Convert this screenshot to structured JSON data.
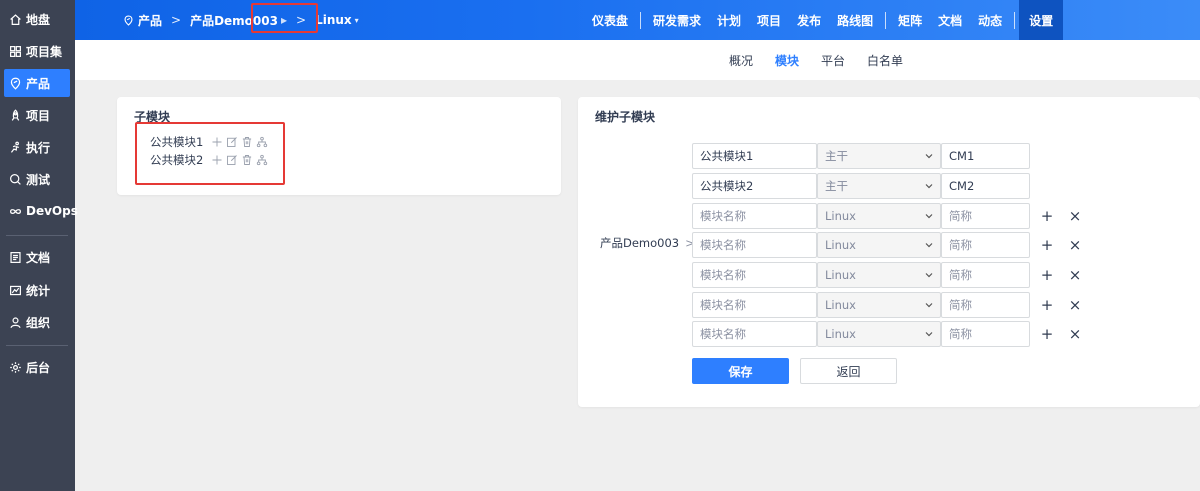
{
  "sidebar": {
    "items": [
      {
        "label": "地盘",
        "icon": "home-icon"
      },
      {
        "label": "项目集",
        "icon": "grid-icon"
      },
      {
        "label": "产品",
        "icon": "product-icon"
      },
      {
        "label": "项目",
        "icon": "rocket-icon"
      },
      {
        "label": "执行",
        "icon": "run-icon"
      },
      {
        "label": "测试",
        "icon": "test-icon"
      },
      {
        "label": "DevOps",
        "icon": "infinity-icon"
      },
      {
        "label": "文档",
        "icon": "doc-icon"
      },
      {
        "label": "统计",
        "icon": "chart-icon"
      },
      {
        "label": "组织",
        "icon": "user-icon"
      },
      {
        "label": "后台",
        "icon": "gear-icon"
      }
    ],
    "active_index": 2
  },
  "header": {
    "breadcrumb": {
      "home": "产品",
      "product": "产品Demo003",
      "branch": "Linux"
    },
    "nav": [
      "仪表盘",
      "研发需求",
      "计划",
      "项目",
      "发布",
      "路线图",
      "矩阵",
      "文档",
      "动态",
      "设置"
    ],
    "active_nav": "设置"
  },
  "subnav": {
    "items": [
      "概况",
      "模块",
      "平台",
      "白名单"
    ],
    "active": "模块"
  },
  "left_card": {
    "title": "子模块",
    "modules": [
      "公共模块1",
      "公共模块2"
    ]
  },
  "right_card": {
    "title": "维护子模块",
    "parent_label": "产品Demo003",
    "rows": [
      {
        "name": "公共模块1",
        "branch": "主干",
        "short": "CM1",
        "placeholder_name": "模块名称",
        "placeholder_short": "简称"
      },
      {
        "name": "公共模块2",
        "branch": "主干",
        "short": "CM2",
        "placeholder_name": "模块名称",
        "placeholder_short": "简称"
      },
      {
        "name": "",
        "branch": "Linux",
        "short": "",
        "placeholder_name": "模块名称",
        "placeholder_short": "简称"
      },
      {
        "name": "",
        "branch": "Linux",
        "short": "",
        "placeholder_name": "模块名称",
        "placeholder_short": "简称"
      },
      {
        "name": "",
        "branch": "Linux",
        "short": "",
        "placeholder_name": "模块名称",
        "placeholder_short": "简称"
      },
      {
        "name": "",
        "branch": "Linux",
        "short": "",
        "placeholder_name": "模块名称",
        "placeholder_short": "简称"
      },
      {
        "name": "",
        "branch": "Linux",
        "short": "",
        "placeholder_name": "模块名称",
        "placeholder_short": "简称"
      }
    ],
    "save_label": "保存",
    "back_label": "返回"
  },
  "colors": {
    "primary": "#2e7fff",
    "sidebar_bg": "#3c4353",
    "header_start": "#0f63e6",
    "header_end": "#3b8cf8",
    "highlight": "#e53935"
  }
}
